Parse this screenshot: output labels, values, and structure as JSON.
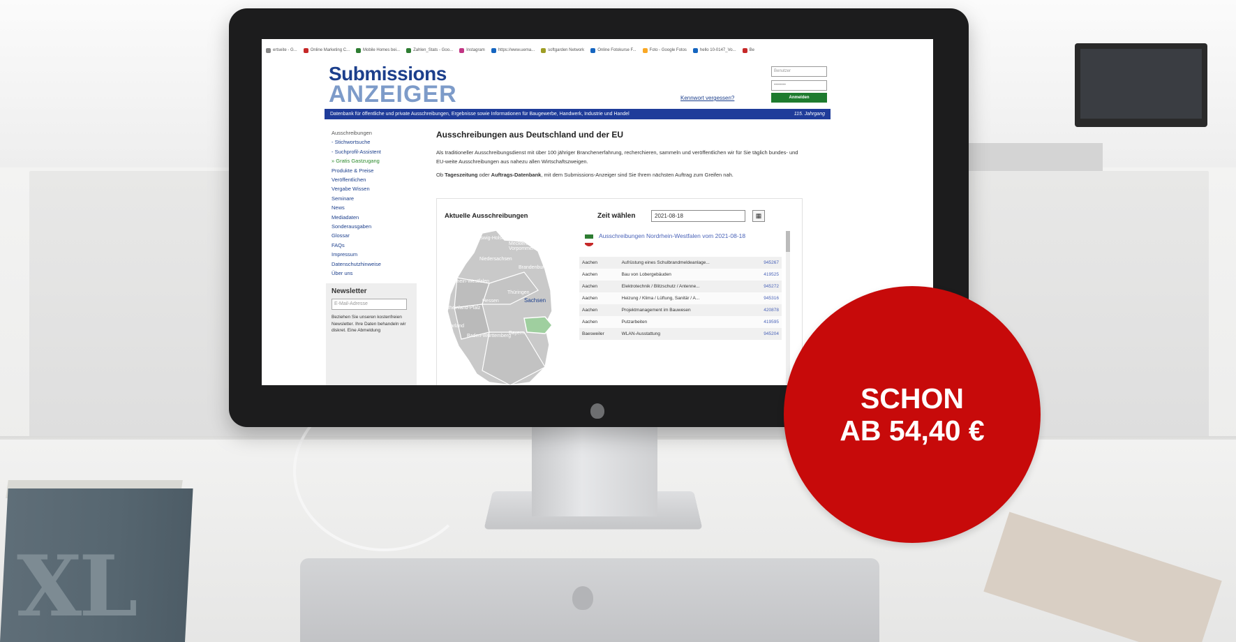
{
  "bookmarks": [
    {
      "label": "ertseite - G...",
      "color": "#888888"
    },
    {
      "label": "Online Marketing C...",
      "color": "#c62828"
    },
    {
      "label": "Mobile Homes bei...",
      "color": "#2e7d32"
    },
    {
      "label": "Zahlen_Stats - Goo...",
      "color": "#2e7d32"
    },
    {
      "label": "Instagram",
      "color": "#c13584"
    },
    {
      "label": "https://www.uema...",
      "color": "#1565c0"
    },
    {
      "label": "softgarden Network",
      "color": "#9e9d24"
    },
    {
      "label": "Online Fotokurse F...",
      "color": "#1565c0"
    },
    {
      "label": "Foto - Google Fotos",
      "color": "#f9a825"
    },
    {
      "label": "hello 10-0147_Vo...",
      "color": "#1565c0"
    },
    {
      "label": "Be",
      "color": "#c62828"
    }
  ],
  "site": {
    "logo_line1": "Submissions",
    "logo_line2": "ANZEIGER",
    "login_user_placeholder": "Benutzer",
    "login_pass_placeholder": "••••••••",
    "forgot": "Kennwort vergessen?",
    "login_button": "Anmelden",
    "topbar_text": "Datenbank für öffentliche und private Ausschreibungen, Ergebnisse sowie Informationen für Baugewerbe, Handwerk, Industrie und Handel",
    "topbar_year": "115. Jahrgang"
  },
  "nav": [
    {
      "label": "Ausschreibungen",
      "style": "grey"
    },
    {
      "label": "- Stichwortsuche",
      "style": "link"
    },
    {
      "label": "- Suchprofil-Assistent",
      "style": "link"
    },
    {
      "label": "» Gratis Gastzugang",
      "style": "green"
    },
    {
      "label": "Produkte & Preise",
      "style": "link"
    },
    {
      "label": "Veröffentlichen",
      "style": "link"
    },
    {
      "label": "Vergabe Wissen",
      "style": "link"
    },
    {
      "label": "Seminare",
      "style": "link"
    },
    {
      "label": "News",
      "style": "link"
    },
    {
      "label": "Mediadaten",
      "style": "link"
    },
    {
      "label": "Sonderausgaben",
      "style": "link"
    },
    {
      "label": "Glossar",
      "style": "link"
    },
    {
      "label": "FAQs",
      "style": "link"
    },
    {
      "label": "Impressum",
      "style": "link"
    },
    {
      "label": "Datenschutzhinweise",
      "style": "link"
    },
    {
      "label": "Über uns",
      "style": "link"
    }
  ],
  "newsletter": {
    "title": "Newsletter",
    "placeholder": "E-Mail-Adresse",
    "text": "Beziehen Sie unseren kostenfreien Newsletter. Ihre Daten behandeln wir diskret. Eine Abmeldung"
  },
  "main": {
    "title": "Ausschreibungen aus Deutschland und der EU",
    "intro1": "Als traditioneller Ausschreibungsdienst mit über 100 jähriger Branchenerfahrung, recherchieren, sammeln und veröffentlichen wir für Sie täglich bundes- und EU-weite Ausschreibungen aus nahezu allen Wirtschaftszweigen.",
    "intro2_a": "Ob ",
    "intro2_b": "Tageszeitung",
    "intro2_c": " oder ",
    "intro2_d": "Auftrags-Datenbank",
    "intro2_e": ", mit dem Submissions-Anzeiger sind Sie Ihrem nächsten Auftrag zum Greifen nah.",
    "panel_title": "Aktuelle Ausschreibungen",
    "zeit_label": "Zeit wählen",
    "zeit_value": "2021-08-18",
    "region_link": "Ausschreibungen Nordrhein-Westfalen vom 2021-08-18"
  },
  "map_labels": [
    {
      "text": "Schleswig-Holstein",
      "cls": "light"
    },
    {
      "text": "Mecklenburg-Vorpommern",
      "cls": "light"
    },
    {
      "text": "Niedersachsen",
      "cls": "light"
    },
    {
      "text": "Brandenburg",
      "cls": "light"
    },
    {
      "text": "Nordrhein-Westfalen",
      "cls": "light"
    },
    {
      "text": "Sachsen",
      "cls": "dark"
    },
    {
      "text": "Hessen",
      "cls": "light"
    },
    {
      "text": "Thüringen",
      "cls": "light"
    },
    {
      "text": "Rheinland-Pfalz",
      "cls": "light"
    },
    {
      "text": "Saarland",
      "cls": "light"
    },
    {
      "text": "Bayern",
      "cls": "light"
    },
    {
      "text": "Baden-Württemberg",
      "cls": "light"
    }
  ],
  "tenders": [
    {
      "city": "Aachen",
      "title": "Aufrüstung eines Schulbrandmeldeanlage...",
      "id": "945267"
    },
    {
      "city": "Aachen",
      "title": "Bau von Lobergebäuden",
      "id": "419525"
    },
    {
      "city": "Aachen",
      "title": "Elektrotechnik / Blitzschutz / Antenne...",
      "id": "945272"
    },
    {
      "city": "Aachen",
      "title": "Heizung / Klima / Lüftung, Sanitär / A...",
      "id": "945316"
    },
    {
      "city": "Aachen",
      "title": "Projektmanagement im Bauwesen",
      "id": "420878"
    },
    {
      "city": "Aachen",
      "title": "Putzarbeiten",
      "id": "419595"
    },
    {
      "city": "Baesweiler",
      "title": "WLAN-Ausstattung",
      "id": "945204"
    }
  ],
  "badge": {
    "line1": "SCHON",
    "line2": "AB 54,40 €",
    "color": "#c70a0a"
  },
  "book_letters": "XL"
}
